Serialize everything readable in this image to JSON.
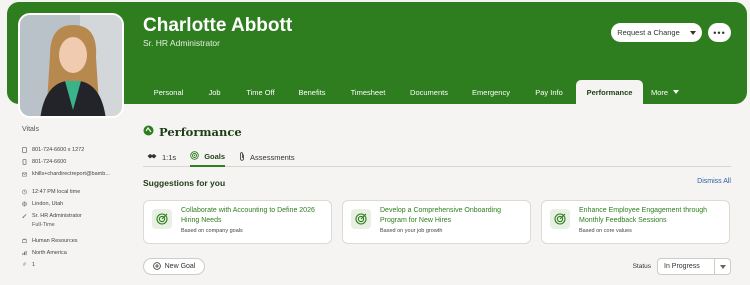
{
  "profile": {
    "name": "Charlotte Abbott",
    "title": "Sr. HR Administrator"
  },
  "header": {
    "request_change": "Request a Change",
    "more_actions": "•••"
  },
  "tabs": [
    {
      "label": "Personal"
    },
    {
      "label": "Job"
    },
    {
      "label": "Time Off"
    },
    {
      "label": "Benefits"
    },
    {
      "label": "Timesheet"
    },
    {
      "label": "Documents"
    },
    {
      "label": "Emergency"
    },
    {
      "label": "Pay Info"
    },
    {
      "label": "Performance"
    },
    {
      "label": "More"
    }
  ],
  "vitals": {
    "title": "Vitals",
    "work_phone": "801-724-6600 x 1272",
    "mobile_phone": "801-724-6600",
    "email": "khills+chardirectreport@bamb...",
    "local_time": "12:47 PM local time",
    "location": "Lindon, Utah",
    "job_title": "Sr. HR Administrator",
    "employment": "Full-Time",
    "department": "Human Resources",
    "region": "North America",
    "employee_number": "1",
    "number_sign": "#"
  },
  "performance": {
    "title": "Performance",
    "subtabs": {
      "one_on_one": "1:1s",
      "goals": "Goals",
      "assessments": "Assessments"
    },
    "suggestions_title": "Suggestions for you",
    "dismiss_all": "Dismiss All",
    "cards": [
      {
        "title": "Collaborate with Accounting to Define 2026 Hiring Needs",
        "sub": "Based on company goals"
      },
      {
        "title": "Develop a Comprehensive Onboarding Program for New Hires",
        "sub": "Based on your job growth"
      },
      {
        "title": "Enhance Employee Engagement through Monthly Feedback Sessions",
        "sub": "Based on core values"
      }
    ],
    "new_goal": "New Goal",
    "status_label": "Status",
    "status_value": "In Progress"
  },
  "colors": {
    "brand_green": "#2e7d1e",
    "link_blue": "#2a5fa8",
    "background": "#f5f4f2"
  }
}
